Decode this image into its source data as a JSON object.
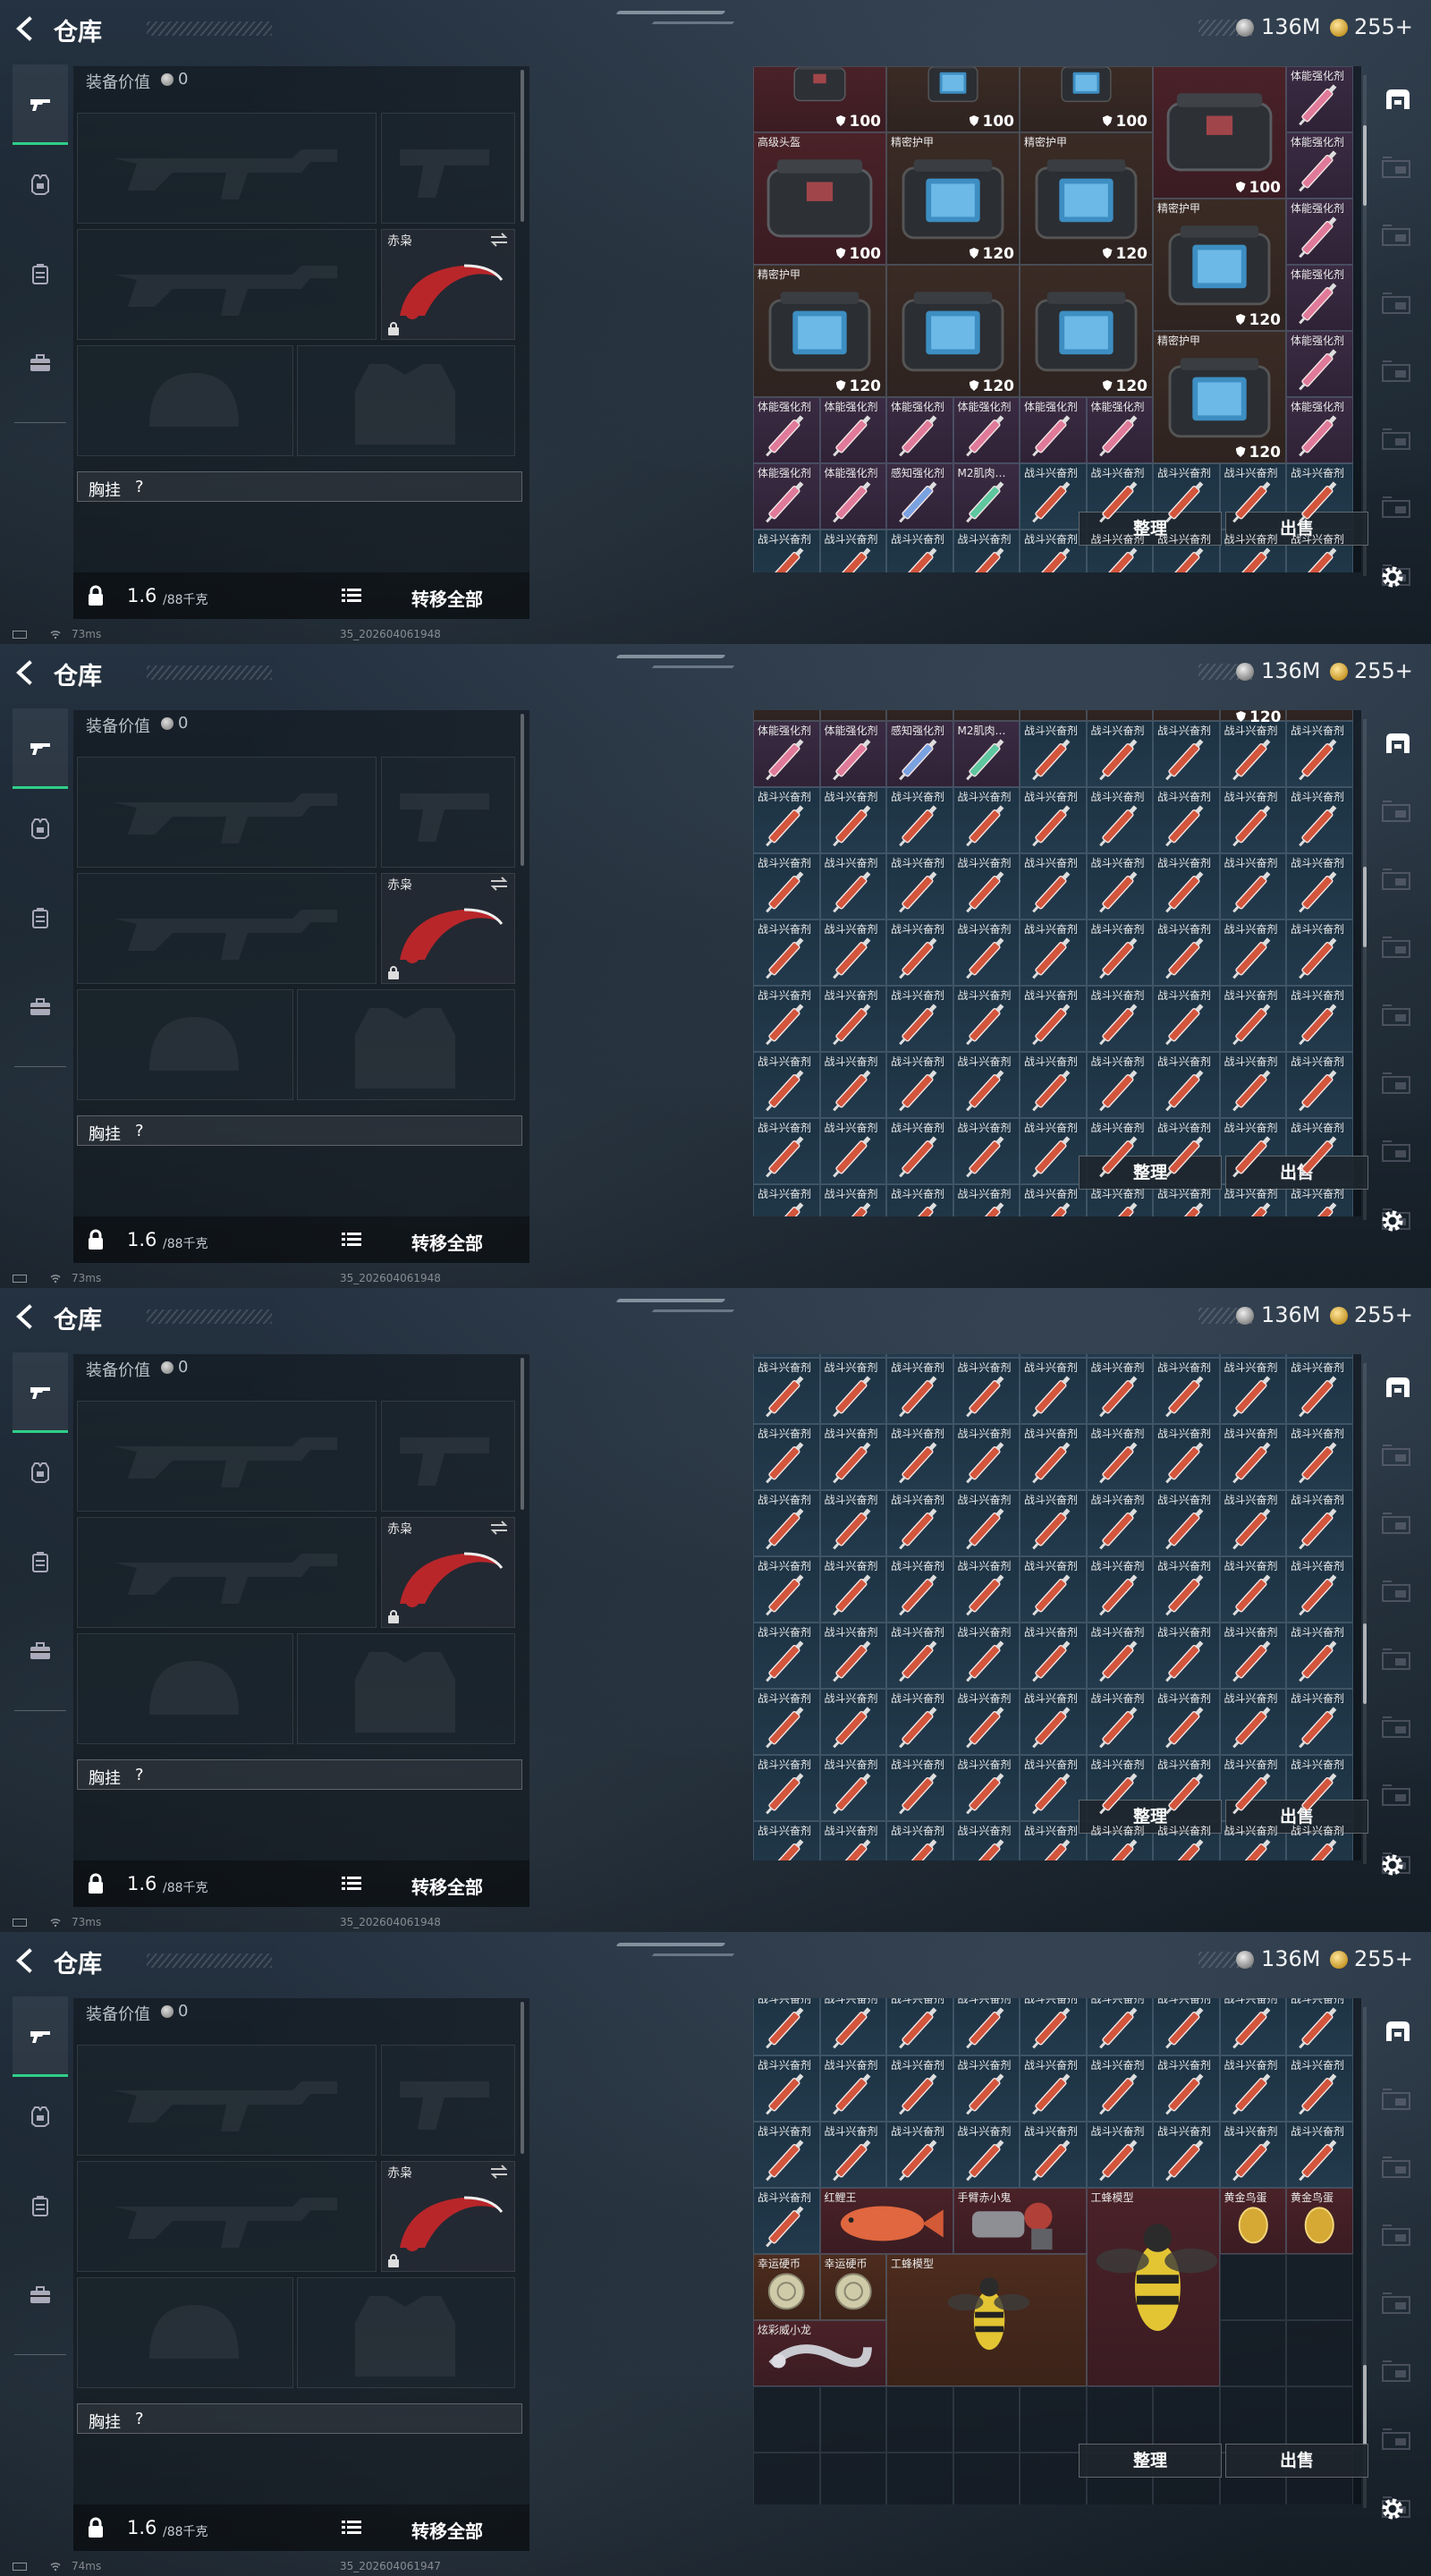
{
  "screens": [
    {
      "title": "仓库",
      "currency": {
        "silver": "136M",
        "gold": "255+"
      },
      "loadout": {
        "value_label": "装备价值",
        "value": "0",
        "knife_name": "赤枭",
        "chest_label": "胸挂",
        "chest_value": "?",
        "weight": "1.6",
        "weight_max": "/88千克",
        "transfer_all": "转移全部"
      },
      "buttons": {
        "sort": "整理",
        "sell": "出售"
      },
      "status": {
        "ping": "73ms",
        "build": "35_202604061948"
      }
    },
    {
      "title": "仓库",
      "currency": {
        "silver": "136M",
        "gold": "255+"
      },
      "loadout": {
        "value_label": "装备价值",
        "value": "0",
        "knife_name": "赤枭",
        "chest_label": "胸挂",
        "chest_value": "?",
        "weight": "1.6",
        "weight_max": "/88千克",
        "transfer_all": "转移全部"
      },
      "buttons": {
        "sort": "整理",
        "sell": "出售"
      },
      "status": {
        "ping": "73ms",
        "build": "35_202604061948"
      }
    },
    {
      "title": "仓库",
      "currency": {
        "silver": "136M",
        "gold": "255+"
      },
      "loadout": {
        "value_label": "装备价值",
        "value": "0",
        "knife_name": "赤枭",
        "chest_label": "胸挂",
        "chest_value": "?",
        "weight": "1.6",
        "weight_max": "/88千克",
        "transfer_all": "转移全部"
      },
      "buttons": {
        "sort": "整理",
        "sell": "出售"
      },
      "status": {
        "ping": "73ms",
        "build": "35_202604061948"
      }
    },
    {
      "title": "仓库",
      "currency": {
        "silver": "136M",
        "gold": "255+"
      },
      "loadout": {
        "value_label": "装备价值",
        "value": "0",
        "knife_name": "赤枭",
        "chest_label": "胸挂",
        "chest_value": "?",
        "weight": "1.6",
        "weight_max": "/88千克",
        "transfer_all": "转移全部"
      },
      "buttons": {
        "sort": "整理",
        "sell": "出售"
      },
      "status": {
        "ping": "74ms",
        "build": "35_202604061947"
      }
    }
  ],
  "grid_rows": [
    [
      [
        {
          "c": 0,
          "r": 0,
          "w": 2,
          "h": 1,
          "label": "",
          "dur": "100",
          "color": "red",
          "item": "helmet-partial"
        },
        {
          "c": 2,
          "r": 0,
          "w": 2,
          "h": 1,
          "label": "",
          "dur": "100",
          "color": "brown",
          "item": "armor-partial"
        },
        {
          "c": 4,
          "r": 0,
          "w": 2,
          "h": 1,
          "label": "",
          "dur": "100",
          "color": "brown",
          "item": "armor-partial"
        },
        {
          "c": 6,
          "r": 0,
          "w": 2,
          "h": 2,
          "label": "",
          "dur": "100",
          "color": "red",
          "item": "helmet"
        },
        {
          "c": 8,
          "r": 0,
          "w": 1,
          "h": 1,
          "label": "体能强化剂",
          "color": "purple",
          "item": "syringe-pink"
        },
        {
          "c": 0,
          "r": 1,
          "w": 2,
          "h": 2,
          "label": "高级头盔",
          "dur": "100",
          "color": "red",
          "item": "helmet"
        },
        {
          "c": 2,
          "r": 1,
          "w": 2,
          "h": 2,
          "label": "精密护甲",
          "dur": "120",
          "color": "brown",
          "item": "armor"
        },
        {
          "c": 4,
          "r": 1,
          "w": 2,
          "h": 2,
          "label": "精密护甲",
          "dur": "120",
          "color": "brown",
          "item": "armor"
        },
        {
          "c": 8,
          "r": 1,
          "w": 1,
          "h": 1,
          "label": "体能强化剂",
          "color": "purple",
          "item": "syringe-pink"
        },
        {
          "c": 6,
          "r": 2,
          "w": 2,
          "h": 2,
          "label": "精密护甲",
          "dur": "120",
          "color": "brown",
          "item": "armor"
        },
        {
          "c": 8,
          "r": 2,
          "w": 1,
          "h": 1,
          "label": "体能强化剂",
          "color": "purple",
          "item": "syringe-pink"
        },
        {
          "c": 0,
          "r": 3,
          "w": 2,
          "h": 2,
          "label": "精密护甲",
          "dur": "120",
          "color": "brown",
          "item": "armor"
        },
        {
          "c": 2,
          "r": 3,
          "w": 2,
          "h": 2,
          "label": "",
          "dur": "120",
          "color": "brown",
          "item": "armor"
        },
        {
          "c": 4,
          "r": 3,
          "w": 2,
          "h": 2,
          "label": "",
          "dur": "120",
          "color": "brown",
          "item": "armor"
        },
        {
          "c": 8,
          "r": 3,
          "w": 1,
          "h": 1,
          "label": "体能强化剂",
          "color": "purple",
          "item": "syringe-pink"
        },
        {
          "c": 6,
          "r": 4,
          "w": 2,
          "h": 2,
          "label": "精密护甲",
          "dur": "120",
          "color": "brown",
          "item": "armor"
        },
        {
          "c": 8,
          "r": 4,
          "w": 1,
          "h": 1,
          "label": "体能强化剂",
          "color": "purple",
          "item": "syringe-pink"
        },
        {
          "c": 0,
          "r": 5,
          "w": 1,
          "h": 1,
          "label": "体能强化剂",
          "color": "purple",
          "item": "syringe-pink"
        },
        {
          "c": 1,
          "r": 5,
          "w": 1,
          "h": 1,
          "label": "体能强化剂",
          "color": "purple",
          "item": "syringe-pink"
        },
        {
          "c": 2,
          "r": 5,
          "w": 1,
          "h": 1,
          "label": "体能强化剂",
          "color": "purple",
          "item": "syringe-pink"
        },
        {
          "c": 3,
          "r": 5,
          "w": 1,
          "h": 1,
          "label": "体能强化剂",
          "color": "purple",
          "item": "syringe-pink"
        },
        {
          "c": 4,
          "r": 5,
          "w": 1,
          "h": 1,
          "label": "体能强化剂",
          "color": "purple",
          "item": "syringe-pink"
        },
        {
          "c": 5,
          "r": 5,
          "w": 1,
          "h": 1,
          "label": "体能强化剂",
          "color": "purple",
          "item": "syringe-pink"
        },
        {
          "c": 8,
          "r": 5,
          "w": 1,
          "h": 1,
          "label": "体能强化剂",
          "color": "purple",
          "item": "syringe-pink"
        },
        {
          "c": 0,
          "r": 6,
          "w": 1,
          "h": 1,
          "label": "体能强化剂",
          "color": "purple",
          "item": "syringe-pink"
        },
        {
          "c": 1,
          "r": 6,
          "w": 1,
          "h": 1,
          "label": "体能强化剂",
          "color": "purple",
          "item": "syringe-pink"
        },
        {
          "c": 2,
          "r": 6,
          "w": 1,
          "h": 1,
          "label": "感知强化剂",
          "color": "purple",
          "item": "syringe-blue"
        },
        {
          "c": 3,
          "r": 6,
          "w": 1,
          "h": 1,
          "label": "M2肌肉…",
          "color": "purple",
          "item": "syringe-green"
        },
        {
          "c": 4,
          "r": 6,
          "w": 1,
          "h": 1,
          "label": "战斗兴奋剂",
          "color": "blue",
          "item": "syringe-red"
        },
        {
          "c": 5,
          "r": 6,
          "w": 1,
          "h": 1,
          "label": "战斗兴奋剂",
          "color": "blue",
          "item": "syringe-red"
        },
        {
          "c": 6,
          "r": 6,
          "w": 1,
          "h": 1,
          "label": "战斗兴奋剂",
          "color": "blue",
          "item": "syringe-red"
        },
        {
          "c": 7,
          "r": 6,
          "w": 1,
          "h": 1,
          "label": "战斗兴奋剂",
          "color": "blue",
          "item": "syringe-red"
        },
        {
          "c": 8,
          "r": 6,
          "w": 1,
          "h": 1,
          "label": "战斗兴奋剂",
          "color": "blue",
          "item": "syringe-red"
        },
        {
          "c": 0,
          "r": 7,
          "w": 1,
          "h": 1,
          "label": "战斗兴奋剂",
          "color": "blue",
          "item": "syringe-red"
        },
        {
          "c": 1,
          "r": 7,
          "w": 1,
          "h": 1,
          "label": "战斗兴奋剂",
          "color": "blue",
          "item": "syringe-red"
        },
        {
          "c": 2,
          "r": 7,
          "w": 1,
          "h": 1,
          "label": "战斗兴奋剂",
          "color": "blue",
          "item": "syringe-red"
        },
        {
          "c": 3,
          "r": 7,
          "w": 1,
          "h": 1,
          "label": "战斗兴奋剂",
          "color": "blue",
          "item": "syringe-red"
        },
        {
          "c": 4,
          "r": 7,
          "w": 1,
          "h": 1,
          "label": "战斗兴奋剂",
          "color": "blue",
          "item": "syringe-red"
        },
        {
          "c": 5,
          "r": 7,
          "w": 1,
          "h": 1,
          "label": "战斗兴奋剂",
          "color": "blue",
          "item": "syringe-red"
        },
        {
          "c": 6,
          "r": 7,
          "w": 1,
          "h": 1,
          "label": "战斗兴奋剂",
          "color": "blue",
          "item": "syringe-red"
        },
        {
          "c": 7,
          "r": 7,
          "w": 1,
          "h": 1,
          "label": "战斗兴奋剂",
          "color": "blue",
          "item": "syringe-red"
        },
        {
          "c": 8,
          "r": 7,
          "w": 1,
          "h": 1,
          "label": "战斗兴奋剂",
          "color": "blue",
          "item": "syringe-red"
        }
      ]
    ],
    [
      [
        {
          "c": 0,
          "r": 0,
          "w": 1,
          "h": 1,
          "label": "体能强化剂",
          "color": "purple",
          "item": "syringe-pink"
        },
        {
          "c": 1,
          "r": 0,
          "w": 1,
          "h": 1,
          "label": "体能强化剂",
          "color": "purple",
          "item": "syringe-pink"
        },
        {
          "c": 2,
          "r": 0,
          "w": 1,
          "h": 1,
          "label": "感知强化剂",
          "color": "purple",
          "item": "syringe-blue"
        },
        {
          "c": 3,
          "r": 0,
          "w": 1,
          "h": 1,
          "label": "M2肌肉…",
          "color": "purple",
          "item": "syringe-green"
        }
      ]
    ],
    [],
    [
      [
        {
          "c": 0,
          "r": 3,
          "w": 1,
          "h": 1,
          "label": "战斗兴奋剂",
          "color": "blue",
          "item": "syringe-red"
        },
        {
          "c": 1,
          "r": 3,
          "w": 2,
          "h": 1,
          "label": "红鲤王",
          "color": "red",
          "item": "fish"
        },
        {
          "c": 3,
          "r": 3,
          "w": 2,
          "h": 1,
          "label": "手臂赤小鬼",
          "color": "red",
          "item": "figure"
        },
        {
          "c": 5,
          "r": 3,
          "w": 2,
          "h": 3,
          "label": "工蜂模型",
          "color": "red",
          "item": "bee"
        },
        {
          "c": 7,
          "r": 3,
          "w": 1,
          "h": 1,
          "label": "黄金鸟蛋",
          "color": "red",
          "item": "egg"
        },
        {
          "c": 8,
          "r": 3,
          "w": 1,
          "h": 1,
          "label": "黄金鸟蛋",
          "color": "red",
          "item": "egg"
        },
        {
          "c": 0,
          "r": 4,
          "w": 1,
          "h": 1,
          "label": "幸运硬币",
          "color": "orange",
          "item": "coin"
        },
        {
          "c": 1,
          "r": 4,
          "w": 1,
          "h": 1,
          "label": "幸运硬币",
          "color": "orange",
          "item": "coin"
        },
        {
          "c": 2,
          "r": 4,
          "w": 3,
          "h": 2,
          "label": "工蜂模型",
          "color": "orange",
          "item": "bee"
        },
        {
          "c": 0,
          "r": 5,
          "w": 2,
          "h": 1,
          "label": "炫彩威小龙",
          "color": "red",
          "item": "dragon"
        }
      ]
    ]
  ],
  "top_dur_strip": [
    "",
    "120",
    "",
    ""
  ],
  "ui_colors": {
    "accent_green": "#2fcf88",
    "cell_blue": "#1d3344",
    "cell_red": "#4a2228",
    "cell_purple": "#3a2b42"
  },
  "scroll_fraction": [
    0.12,
    0.35,
    0.62,
    0.85
  ]
}
